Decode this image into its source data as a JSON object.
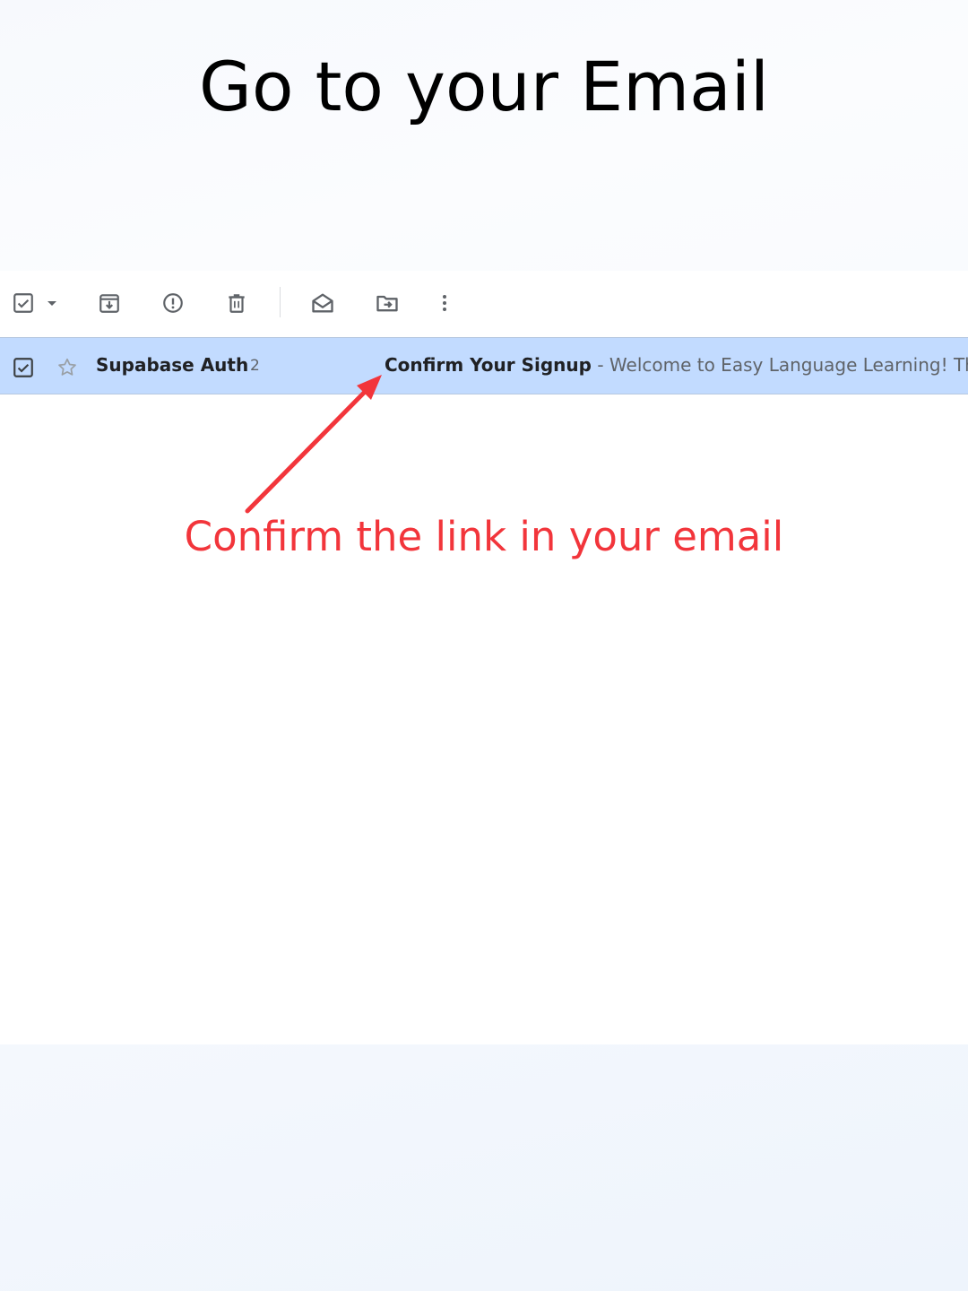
{
  "page": {
    "title": "Go to your Email"
  },
  "toolbar": {
    "icons": [
      {
        "name": "select-all-checkbox",
        "icon": "checkbox-checked-icon"
      },
      {
        "name": "select-dropdown",
        "icon": "caret-down-icon"
      },
      {
        "name": "archive",
        "icon": "archive-icon"
      },
      {
        "name": "report-spam",
        "icon": "report-spam-icon"
      },
      {
        "name": "delete",
        "icon": "trash-icon"
      },
      {
        "name": "mark-as-read",
        "icon": "envelope-open-icon"
      },
      {
        "name": "move-to",
        "icon": "move-to-folder-icon"
      },
      {
        "name": "more",
        "icon": "more-vertical-icon"
      }
    ]
  },
  "email_row": {
    "selected": true,
    "starred": false,
    "sender": "Supabase Auth",
    "count": "2",
    "subject": "Confirm Your Signup",
    "separator": " - ",
    "snippet": "Welcome to Easy Language Learning! Th"
  },
  "annotation": {
    "text": "Confirm the link in your email",
    "color": "#f2353b"
  },
  "colors": {
    "selected_row_bg": "#c2dbff",
    "icon_gray": "#5f6368",
    "text_dark": "#202124"
  }
}
